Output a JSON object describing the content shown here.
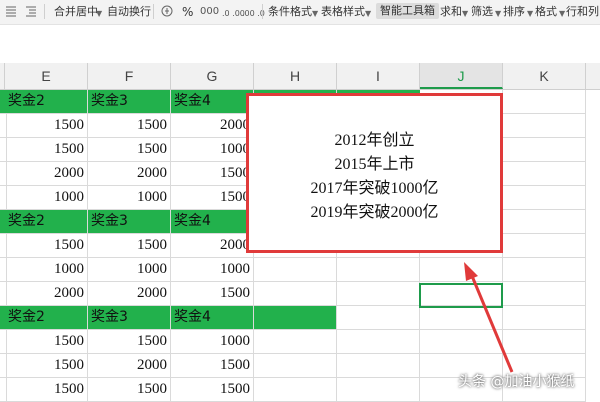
{
  "toolbar": {
    "items": [
      "合并居中",
      "自动换行",
      "条件格式",
      "表格样式",
      "智能工具箱",
      "求和",
      "筛选",
      "排序",
      "格式",
      "行和列"
    ],
    "percent_symbol": "%",
    "thousands_symbol": "000",
    "dec_inc": ".0 .00",
    "dec_dec": ".00 .0"
  },
  "columns": [
    "E",
    "F",
    "G",
    "H",
    "I",
    "J",
    "K"
  ],
  "selected_column": "J",
  "table": {
    "header": [
      "奖金2",
      "奖金3",
      "奖金4"
    ],
    "rows": [
      {
        "type": "header",
        "cells": [
          "奖金2",
          "奖金3",
          "奖金4"
        ]
      },
      {
        "type": "data",
        "cells": [
          "1500",
          "1500",
          "2000"
        ]
      },
      {
        "type": "data",
        "cells": [
          "1500",
          "1500",
          "1000"
        ]
      },
      {
        "type": "data",
        "cells": [
          "2000",
          "2000",
          "1500"
        ]
      },
      {
        "type": "data",
        "cells": [
          "1000",
          "1000",
          "1500"
        ]
      },
      {
        "type": "header",
        "cells": [
          "奖金2",
          "奖金3",
          "奖金4"
        ]
      },
      {
        "type": "data",
        "cells": [
          "1500",
          "1500",
          "2000"
        ]
      },
      {
        "type": "data",
        "cells": [
          "1000",
          "1000",
          "1000"
        ]
      },
      {
        "type": "data",
        "cells": [
          "2000",
          "2000",
          "1500"
        ]
      },
      {
        "type": "header",
        "cells": [
          "奖金2",
          "奖金3",
          "奖金4"
        ]
      },
      {
        "type": "data",
        "cells": [
          "1500",
          "1500",
          "1000"
        ]
      },
      {
        "type": "data",
        "cells": [
          "1500",
          "2000",
          "1500"
        ]
      },
      {
        "type": "data",
        "cells": [
          "1500",
          "1500",
          "1500"
        ]
      }
    ]
  },
  "note": {
    "lines": [
      "2012年创立",
      "2015年上市",
      "2017年突破1000亿",
      "2019年突破2000亿"
    ]
  },
  "watermark": "头条 @加油小猴纸",
  "colors": {
    "header_fill": "#22b14c",
    "annotation_red": "#e03a3a",
    "selection_green": "#1e9b4b"
  }
}
